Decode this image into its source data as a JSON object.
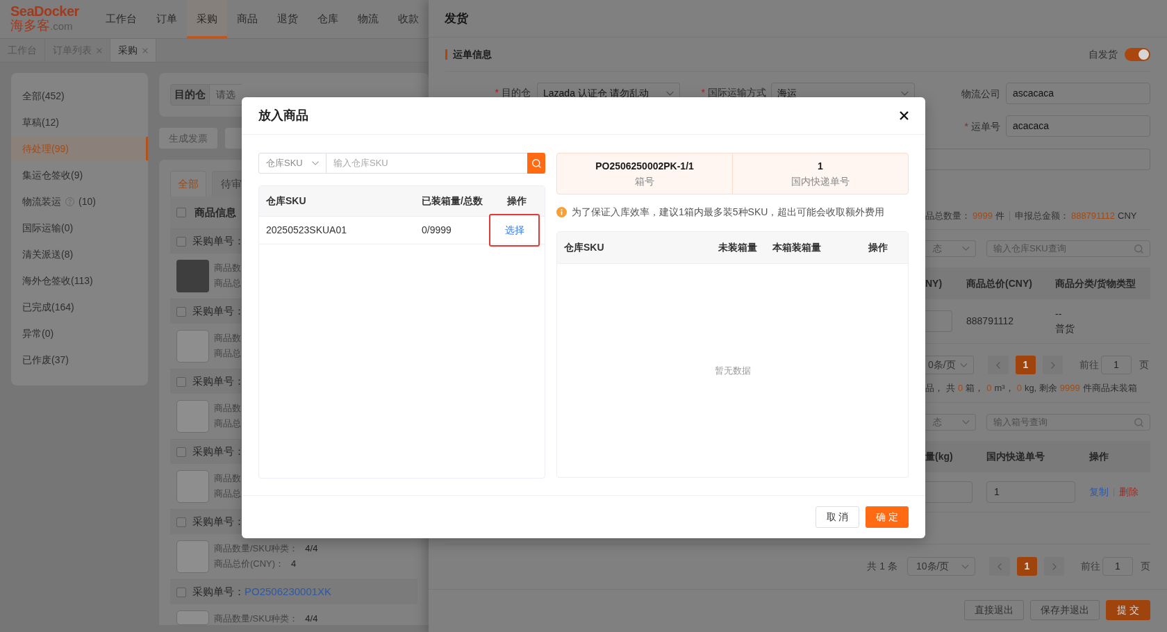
{
  "header": {
    "logo": {
      "brand": "SeaDocker",
      "name": "海多客",
      "domain": ".com"
    },
    "nav": [
      {
        "label": "工作台",
        "selected": false
      },
      {
        "label": "订单",
        "selected": false
      },
      {
        "label": "采购",
        "selected": true
      },
      {
        "label": "商品",
        "selected": false
      },
      {
        "label": "退货",
        "selected": false
      },
      {
        "label": "仓库",
        "selected": false
      },
      {
        "label": "物流",
        "selected": false
      },
      {
        "label": "收款",
        "selected": false
      }
    ]
  },
  "page_tabs": [
    {
      "label": "工作台",
      "closable": false,
      "selected": false
    },
    {
      "label": "订单列表",
      "closable": true,
      "selected": false
    },
    {
      "label": "采购",
      "closable": true,
      "selected": true
    }
  ],
  "sidebar": {
    "items": [
      {
        "label": "全部(452)",
        "help_icon": false,
        "selected": false
      },
      {
        "label": "草稿(12)",
        "help_icon": false,
        "selected": false
      },
      {
        "label": "待处理(99)",
        "help_icon": false,
        "selected": true
      },
      {
        "label": "集运仓签收(9)",
        "help_icon": false,
        "selected": false
      },
      {
        "label": "物流装运",
        "help_icon": true,
        "count": "(10)",
        "selected": false
      },
      {
        "label": "国际运输(0)",
        "help_icon": false,
        "selected": false
      },
      {
        "label": "清关派送(8)",
        "help_icon": false,
        "selected": false
      },
      {
        "label": "海外仓签收(113)",
        "help_icon": false,
        "selected": false
      },
      {
        "label": "已完成(164)",
        "help_icon": false,
        "selected": false
      },
      {
        "label": "异常(0)",
        "help_icon": false,
        "selected": false
      },
      {
        "label": "已作废(37)",
        "help_icon": false,
        "selected": false
      }
    ]
  },
  "filter": {
    "label": "目的仓",
    "placeholder": "请选"
  },
  "actions": [
    {
      "kind": "button",
      "label": "生成发票"
    },
    {
      "kind": "clipped"
    }
  ],
  "list": {
    "tabs": [
      {
        "label": "全部",
        "selected": true
      },
      {
        "label": "待审",
        "selected": false
      }
    ],
    "header": {
      "checked": false,
      "label": "商品信息"
    },
    "orders": [
      {
        "checked": false,
        "label": "采购单号：",
        "image": {
          "kind": "photo"
        },
        "details": [
          {
            "label": "商品数"
          },
          {
            "label": "商品总"
          }
        ]
      },
      {
        "checked": false,
        "label": "采购单号：",
        "image": {
          "kind": "placeholder"
        },
        "details": [
          {
            "label": "商品数"
          },
          {
            "label": "商品总"
          }
        ]
      },
      {
        "checked": false,
        "label": "采购单号：",
        "image": {
          "kind": "placeholder"
        },
        "details": [
          {
            "label": "商品数"
          },
          {
            "label": "商品总"
          }
        ]
      },
      {
        "checked": false,
        "label": "采购单号：",
        "image": {
          "kind": "placeholder"
        },
        "details": [
          {
            "label": "商品数"
          },
          {
            "label": "商品总"
          }
        ]
      },
      {
        "checked": false,
        "label": "采购单号：",
        "image": {
          "kind": "placeholder"
        },
        "details": [
          {
            "label": "商品数量/SKU种类：",
            "value": "4/4"
          },
          {
            "label": "商品总价(CNY)：",
            "value": "4"
          }
        ]
      },
      {
        "checked": false,
        "label": "采购单号：",
        "number": "PO2506230001XK",
        "image": {
          "kind": "placeholder"
        },
        "details": [
          {
            "label": "商品数量/SKU种类：",
            "value": "4/4"
          }
        ]
      }
    ]
  },
  "drawer": {
    "title": "发货",
    "section": "运单信息",
    "self_ship": {
      "label": "自发货",
      "on": true
    },
    "form": [
      [
        {
          "mark": "*",
          "label": "目的仓",
          "kind": "select",
          "value": "Lazada 认证仓 请勿乱动"
        },
        {
          "mark": "*",
          "label": "国际运输方式",
          "kind": "select",
          "value": "海运"
        },
        {
          "label": "物流公司",
          "kind": "input",
          "value": "ascacaca"
        }
      ],
      [
        {
          "mark": "*",
          "label": "运单号",
          "kind": "input",
          "value": "acacaca"
        }
      ],
      [
        {
          "kind": "input"
        }
      ]
    ],
    "totals": [
      {
        "label": "品总数量：",
        "value": "9999",
        "unit": "件"
      },
      {
        "label": "申报总金额：",
        "value": "888791112",
        "unit": "CNY"
      }
    ],
    "sku_filter": {
      "status": "态",
      "placeholder": "输入仓库SKU查询"
    },
    "sku_table": {
      "columns": [
        "NY)",
        "商品总价(CNY)",
        "商品分类/货物类型"
      ],
      "rows": [
        [
          {
            "kind": "input"
          },
          {
            "kind": "text",
            "lines": [
              "888791112"
            ]
          },
          {
            "kind": "text",
            "lines": [
              "--",
              "普货"
            ]
          }
        ]
      ]
    },
    "sku_pagination": {
      "page_size": "0条/页",
      "pages": [
        {
          "label": "1",
          "selected": true
        }
      ],
      "goto": "前往",
      "goto_value": "1",
      "unit": "页"
    },
    "box_summary": [
      {
        "text": "品，",
        "highlight": false
      },
      {
        "text": "共",
        "highlight": false
      },
      {
        "text": "0",
        "highlight": true
      },
      {
        "text": "箱，",
        "highlight": false
      },
      {
        "text": "0",
        "highlight": true
      },
      {
        "text": "m³，",
        "highlight": false
      },
      {
        "text": "0",
        "highlight": true
      },
      {
        "text": "kg, 剩余",
        "highlight": false
      },
      {
        "text": "9999",
        "highlight": true
      },
      {
        "text": "件商品未装箱",
        "highlight": false
      }
    ],
    "box_filter": {
      "status": "态",
      "placeholder": "输入箱号查询"
    },
    "box_table": {
      "columns": [
        "量(kg)",
        "国内快递单号",
        "操作"
      ],
      "rows": [
        [
          {
            "kind": "input"
          },
          {
            "kind": "input",
            "value": "1"
          },
          {
            "kind": "actions",
            "links": [
              {
                "label": "复制",
                "kind": "primary"
              },
              {
                "label": "删除",
                "kind": "danger"
              }
            ]
          }
        ]
      ]
    },
    "pagination": {
      "total": "共 1 条",
      "page_size": "10条/页",
      "pages": [
        {
          "label": "1",
          "selected": true
        }
      ],
      "goto": "前往",
      "goto_value": "1",
      "unit": "页"
    },
    "buttons": [
      {
        "label": "直接退出",
        "kind": "default"
      },
      {
        "label": "保存并退出",
        "kind": "default"
      },
      {
        "label": "提 交",
        "kind": "primary"
      }
    ]
  },
  "modal": {
    "title": "放入商品",
    "search": {
      "field": "仓库SKU",
      "placeholder": "输入仓库SKU"
    },
    "sku_table": {
      "columns": [
        "仓库SKU",
        "已装箱量/总数",
        "操作"
      ],
      "rows": [
        {
          "sku": "20250523SKUA01",
          "packed": "0/9999",
          "action": "选择",
          "highlighted": true
        }
      ]
    },
    "box_info": [
      {
        "value": "PO2506250002PK-1/1",
        "label": "箱号"
      },
      {
        "value": "1",
        "label": "国内快递单号"
      }
    ],
    "notice": "为了保证入库效率，建议1箱内最多装5种SKU，超出可能会收取额外费用",
    "box_table": {
      "columns": [
        "仓库SKU",
        "未装箱量",
        "本箱装箱量",
        "操作"
      ],
      "empty_text": "暂无数据"
    },
    "buttons": [
      {
        "label": "取 消",
        "kind": "default"
      },
      {
        "label": "确 定",
        "kind": "primary"
      }
    ]
  }
}
